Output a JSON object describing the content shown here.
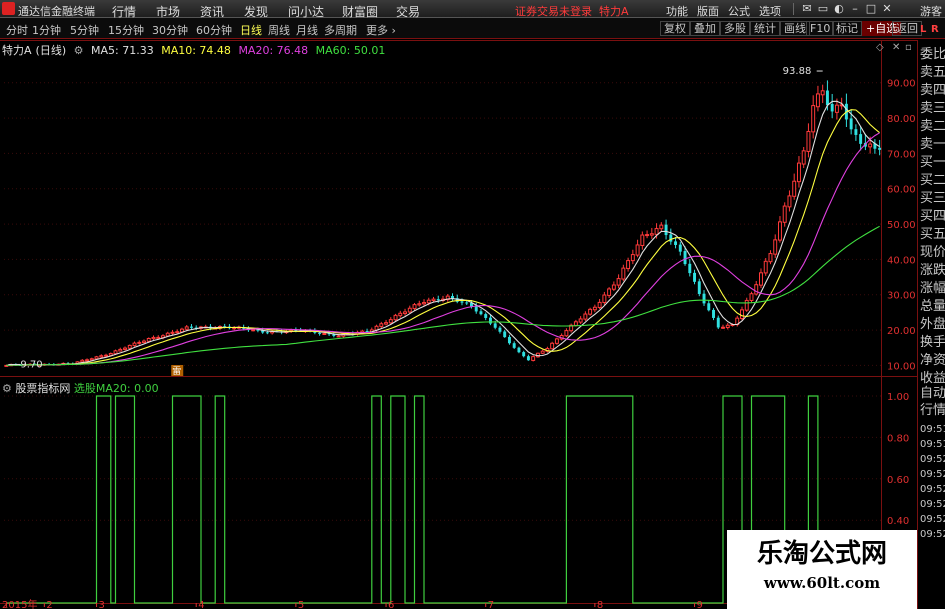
{
  "titlebar": {
    "app_name": "通达信金融终端",
    "menus": [
      "行情",
      "市场",
      "资讯",
      "发现",
      "问小达",
      "财富圈",
      "交易"
    ],
    "warning": "证券交易未登录",
    "stock": "特力A",
    "right_menus": [
      "功能",
      "版面",
      "公式",
      "选项"
    ],
    "user": "游客"
  },
  "toolbar": {
    "periods": [
      "分时",
      "1分钟",
      "5分钟",
      "15分钟",
      "30分钟",
      "60分钟",
      "日线",
      "周线",
      "月线",
      "多周期",
      "更多"
    ],
    "active_period": "日线",
    "right_buttons": [
      "复权",
      "叠加",
      "多股",
      "统计",
      "画线",
      "F10",
      "标记",
      "+自选",
      "返回"
    ],
    "corner_left": "L",
    "corner_right": "R"
  },
  "main_panel": {
    "stock_label": "特力A",
    "period_label": "(日线)",
    "ma": [
      {
        "label": "MA5: 71.33",
        "color": "#e0e0e0"
      },
      {
        "label": "MA10: 74.48",
        "color": "#ffff40"
      },
      {
        "label": "MA20: 76.48",
        "color": "#e040e0"
      },
      {
        "label": "MA60: 50.01",
        "color": "#40e040"
      }
    ],
    "high_label": "93.88",
    "low_label": "9.70",
    "event_marker": "雷"
  },
  "sub_panel": {
    "name": "股票指标网",
    "series_label": "选股MA20: 0.00",
    "y_ticks": [
      "1.00",
      "0.80",
      "0.60",
      "0.40"
    ]
  },
  "right_panel": {
    "labels": [
      "委比",
      "卖五",
      "卖四",
      "卖三",
      "卖二",
      "卖一",
      "买一",
      "买二",
      "买三",
      "买四",
      "买五",
      "现价",
      "涨跌",
      "涨幅",
      "总量",
      "外盘",
      "换手",
      "净资",
      "收益",
      "自动",
      "行情"
    ],
    "times": [
      "09:51",
      "09:51",
      "09:52",
      "09:52",
      "09:52",
      "09:52",
      "09:52",
      "09:52"
    ]
  },
  "watermark": {
    "line1": "乐淘公式网",
    "line2": "www.60lt.com"
  },
  "chart_data": [
    {
      "type": "candlestick",
      "title": "特力A (日线)",
      "y_ticks": [
        10,
        20,
        30,
        40,
        50,
        60,
        70,
        80,
        90
      ],
      "ylim": [
        7,
        97
      ],
      "x_ticks": [
        {
          "label": "2015年",
          "index": 0
        },
        {
          "label": "2",
          "index": 8
        },
        {
          "label": "3",
          "index": 19
        },
        {
          "label": "4",
          "index": 40
        },
        {
          "label": "5",
          "index": 61
        },
        {
          "label": "6",
          "index": 80
        },
        {
          "label": "7",
          "index": 101
        },
        {
          "label": "8",
          "index": 124
        },
        {
          "label": "9",
          "index": 145
        }
      ],
      "close_anchors": [
        [
          0,
          10.0
        ],
        [
          8,
          10.3
        ],
        [
          14,
          10.5
        ],
        [
          22,
          13.5
        ],
        [
          30,
          17.5
        ],
        [
          38,
          20.5
        ],
        [
          46,
          21.0
        ],
        [
          54,
          19.5
        ],
        [
          62,
          19.8
        ],
        [
          70,
          18.5
        ],
        [
          76,
          19.5
        ],
        [
          82,
          24.0
        ],
        [
          88,
          28.0
        ],
        [
          93,
          29.5
        ],
        [
          98,
          26.5
        ],
        [
          103,
          21.0
        ],
        [
          108,
          13.5
        ],
        [
          110,
          11.5
        ],
        [
          114,
          15.0
        ],
        [
          118,
          20.0
        ],
        [
          124,
          26.5
        ],
        [
          129,
          35.0
        ],
        [
          134,
          46.0
        ],
        [
          138,
          49.5
        ],
        [
          142,
          42.0
        ],
        [
          146,
          30.0
        ],
        [
          150,
          21.0
        ],
        [
          153,
          21.5
        ],
        [
          157,
          30.0
        ],
        [
          161,
          42.0
        ],
        [
          164,
          55.0
        ],
        [
          168,
          70.0
        ],
        [
          170,
          83.0
        ],
        [
          172,
          88.0
        ],
        [
          174,
          82.0
        ],
        [
          176,
          85.0
        ],
        [
          178,
          76.0
        ],
        [
          181,
          71.5
        ],
        [
          184,
          71.0
        ]
      ],
      "high": 93.88,
      "low": 9.7,
      "moving_averages": [
        {
          "name": "MA5",
          "value": 71.33,
          "color": "#e0e0e0"
        },
        {
          "name": "MA10",
          "value": 74.48,
          "color": "#ffff40"
        },
        {
          "name": "MA20",
          "value": 76.48,
          "color": "#e040e0"
        },
        {
          "name": "MA60",
          "value": 50.01,
          "color": "#40e040"
        }
      ],
      "up_color": "#ff3a3a",
      "down_color": "#30e0e0"
    },
    {
      "type": "line",
      "series": [
        {
          "name": "选股MA20",
          "color": "#3fcf3f"
        }
      ],
      "ylim": [
        0,
        1
      ],
      "y_ticks": [
        1.0,
        0.8,
        0.6,
        0.4
      ],
      "on_intervals": [
        [
          19,
          21
        ],
        [
          23,
          26
        ],
        [
          35,
          40
        ],
        [
          44,
          45
        ],
        [
          77,
          78
        ],
        [
          81,
          83
        ],
        [
          86,
          87
        ],
        [
          118,
          131
        ],
        [
          151,
          154
        ],
        [
          157,
          163
        ],
        [
          169,
          170
        ]
      ]
    }
  ]
}
